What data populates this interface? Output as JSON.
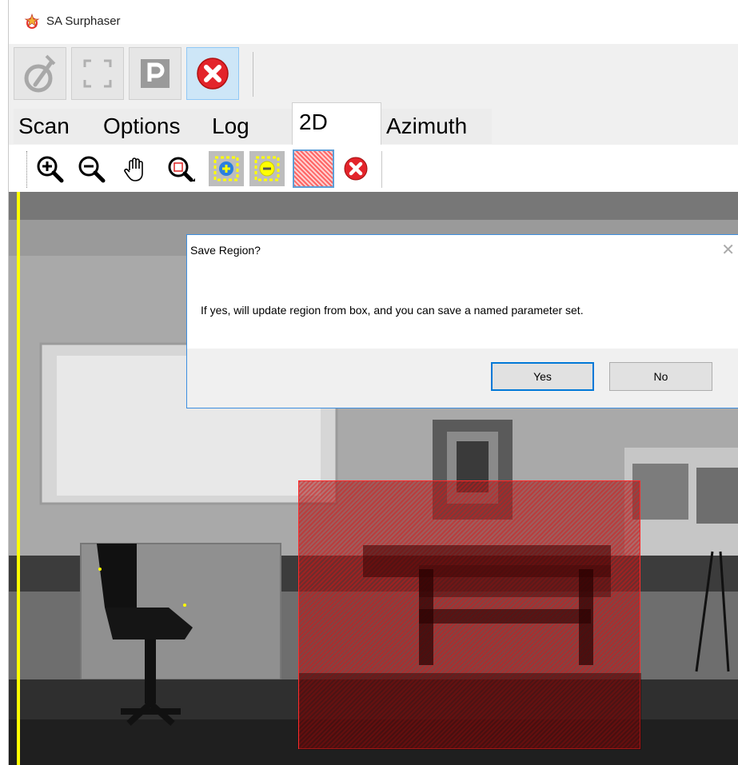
{
  "window": {
    "title": "SA Surphaser"
  },
  "toolbar": {
    "buttons": [
      {
        "name": "scan-icon",
        "state": "disabled"
      },
      {
        "name": "fullscreen-icon",
        "state": "disabled"
      },
      {
        "name": "parking-icon",
        "state": "disabled"
      },
      {
        "name": "stop-icon",
        "state": "active"
      }
    ]
  },
  "tabs": [
    {
      "label": "Scan",
      "selected": false
    },
    {
      "label": "Options",
      "selected": false
    },
    {
      "label": "Log",
      "selected": false
    },
    {
      "label": "2D",
      "selected": true
    },
    {
      "label": "Azimuth",
      "selected": false
    }
  ],
  "view_tools": [
    "zoom-in-icon",
    "zoom-out-icon",
    "pan-hand-icon",
    "zoom-box-icon",
    "add-region-icon",
    "remove-region-icon",
    "region-hatch-icon",
    "clear-icon"
  ],
  "dialog": {
    "title": "Save Region?",
    "close_glyph": "✕",
    "message": "If yes, will update region from box, and you can save a named parameter set.",
    "yes_label": "Yes",
    "no_label": "No"
  },
  "colors": {
    "accent": "#0078d7",
    "region": "#cc2222",
    "marker": "#ffff00",
    "stop": "#e3242b"
  }
}
